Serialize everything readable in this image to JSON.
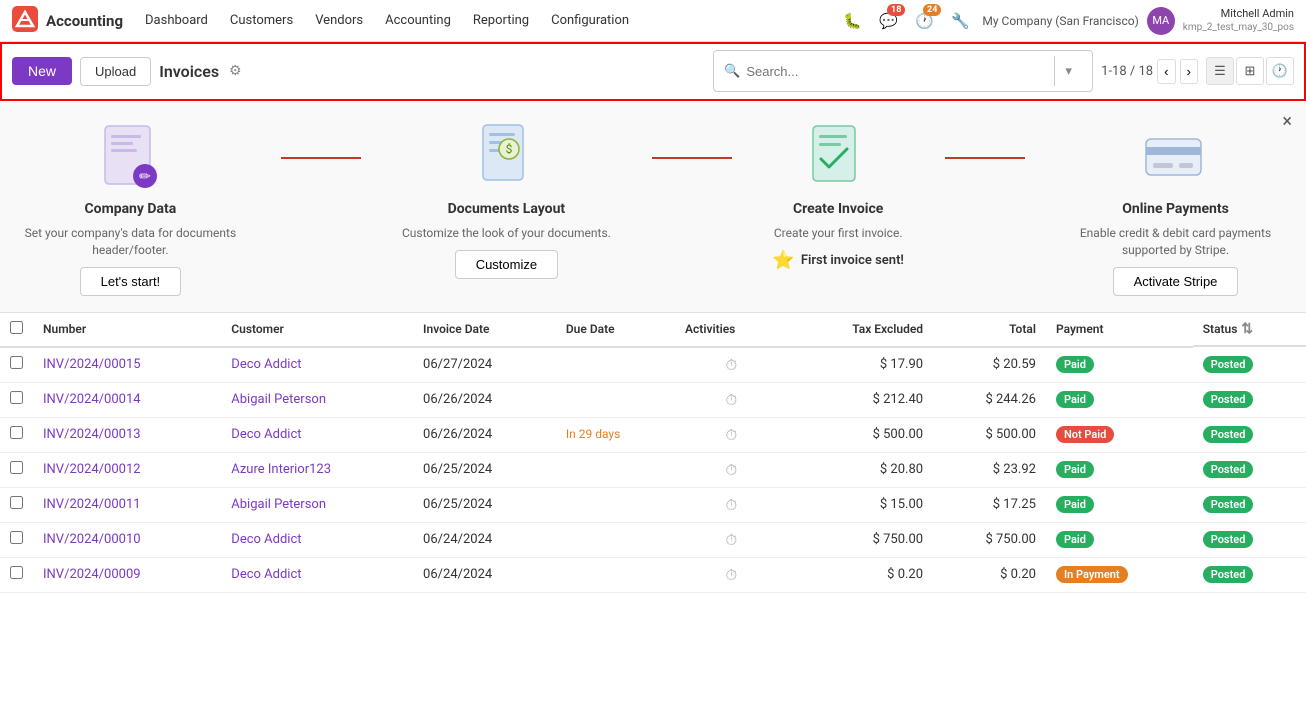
{
  "nav": {
    "brand": "Accounting",
    "items": [
      {
        "label": "Dashboard",
        "active": false
      },
      {
        "label": "Customers",
        "active": false
      },
      {
        "label": "Vendors",
        "active": false
      },
      {
        "label": "Accounting",
        "active": false
      },
      {
        "label": "Reporting",
        "active": false
      },
      {
        "label": "Configuration",
        "active": false
      }
    ],
    "badge_messages": "18",
    "badge_clock": "24",
    "company": "My Company (San Francisco)",
    "user_name": "Mitchell Admin",
    "user_sub": "kmp_2_test_may_30_pos"
  },
  "toolbar": {
    "new_label": "New",
    "upload_label": "Upload",
    "page_title": "Invoices",
    "search_placeholder": "Search...",
    "pagination": "1-18 / 18"
  },
  "onboarding": {
    "close_label": "×",
    "steps": [
      {
        "id": "company-data",
        "title": "Company Data",
        "desc": "Set your company's data for documents header/footer.",
        "btn": "Let's start!",
        "icon": "📄"
      },
      {
        "id": "documents-layout",
        "title": "Documents Layout",
        "desc": "Customize the look of your documents.",
        "btn": "Customize",
        "icon": "📱"
      },
      {
        "id": "create-invoice",
        "title": "Create Invoice",
        "desc": "Create your first invoice.",
        "badge": "First invoice sent!",
        "icon": "✅"
      },
      {
        "id": "online-payments",
        "title": "Online Payments",
        "desc": "Enable credit & debit card payments supported by Stripe.",
        "btn": "Activate Stripe",
        "icon": "💳"
      }
    ]
  },
  "table": {
    "headers": [
      "Number",
      "Customer",
      "Invoice Date",
      "Due Date",
      "Activities",
      "Tax Excluded",
      "Total",
      "Payment",
      "Status"
    ],
    "rows": [
      {
        "number": "INV/2024/00015",
        "customer": "Deco Addict",
        "invoice_date": "06/27/2024",
        "due_date": "",
        "activities": "clock",
        "tax_excluded": "$ 17.90",
        "total": "$ 20.59",
        "payment": "Paid",
        "payment_class": "paid",
        "status": "Posted",
        "status_class": "posted"
      },
      {
        "number": "INV/2024/00014",
        "customer": "Abigail Peterson",
        "invoice_date": "06/26/2024",
        "due_date": "",
        "activities": "clock",
        "tax_excluded": "$ 212.40",
        "total": "$ 244.26",
        "payment": "Paid",
        "payment_class": "paid",
        "status": "Posted",
        "status_class": "posted"
      },
      {
        "number": "INV/2024/00013",
        "customer": "Deco Addict",
        "invoice_date": "06/26/2024",
        "due_date": "In 29 days",
        "activities": "clock",
        "tax_excluded": "$ 500.00",
        "total": "$ 500.00",
        "payment": "Not Paid",
        "payment_class": "notpaid",
        "status": "Posted",
        "status_class": "posted"
      },
      {
        "number": "INV/2024/00012",
        "customer": "Azure Interior123",
        "invoice_date": "06/25/2024",
        "due_date": "",
        "activities": "clock",
        "tax_excluded": "$ 20.80",
        "total": "$ 23.92",
        "payment": "Paid",
        "payment_class": "paid",
        "status": "Posted",
        "status_class": "posted"
      },
      {
        "number": "INV/2024/00011",
        "customer": "Abigail Peterson",
        "invoice_date": "06/25/2024",
        "due_date": "",
        "activities": "clock",
        "tax_excluded": "$ 15.00",
        "total": "$ 17.25",
        "payment": "Paid",
        "payment_class": "paid",
        "status": "Posted",
        "status_class": "posted"
      },
      {
        "number": "INV/2024/00010",
        "customer": "Deco Addict",
        "invoice_date": "06/24/2024",
        "due_date": "",
        "activities": "clock",
        "tax_excluded": "$ 750.00",
        "total": "$ 750.00",
        "payment": "Paid",
        "payment_class": "paid",
        "status": "Posted",
        "status_class": "posted"
      },
      {
        "number": "INV/2024/00009",
        "customer": "Deco Addict",
        "invoice_date": "06/24/2024",
        "due_date": "",
        "activities": "clock",
        "tax_excluded": "$ 0.20",
        "total": "$ 0.20",
        "payment": "In Payment",
        "payment_class": "inpayment",
        "status": "Posted",
        "status_class": "posted"
      }
    ]
  }
}
